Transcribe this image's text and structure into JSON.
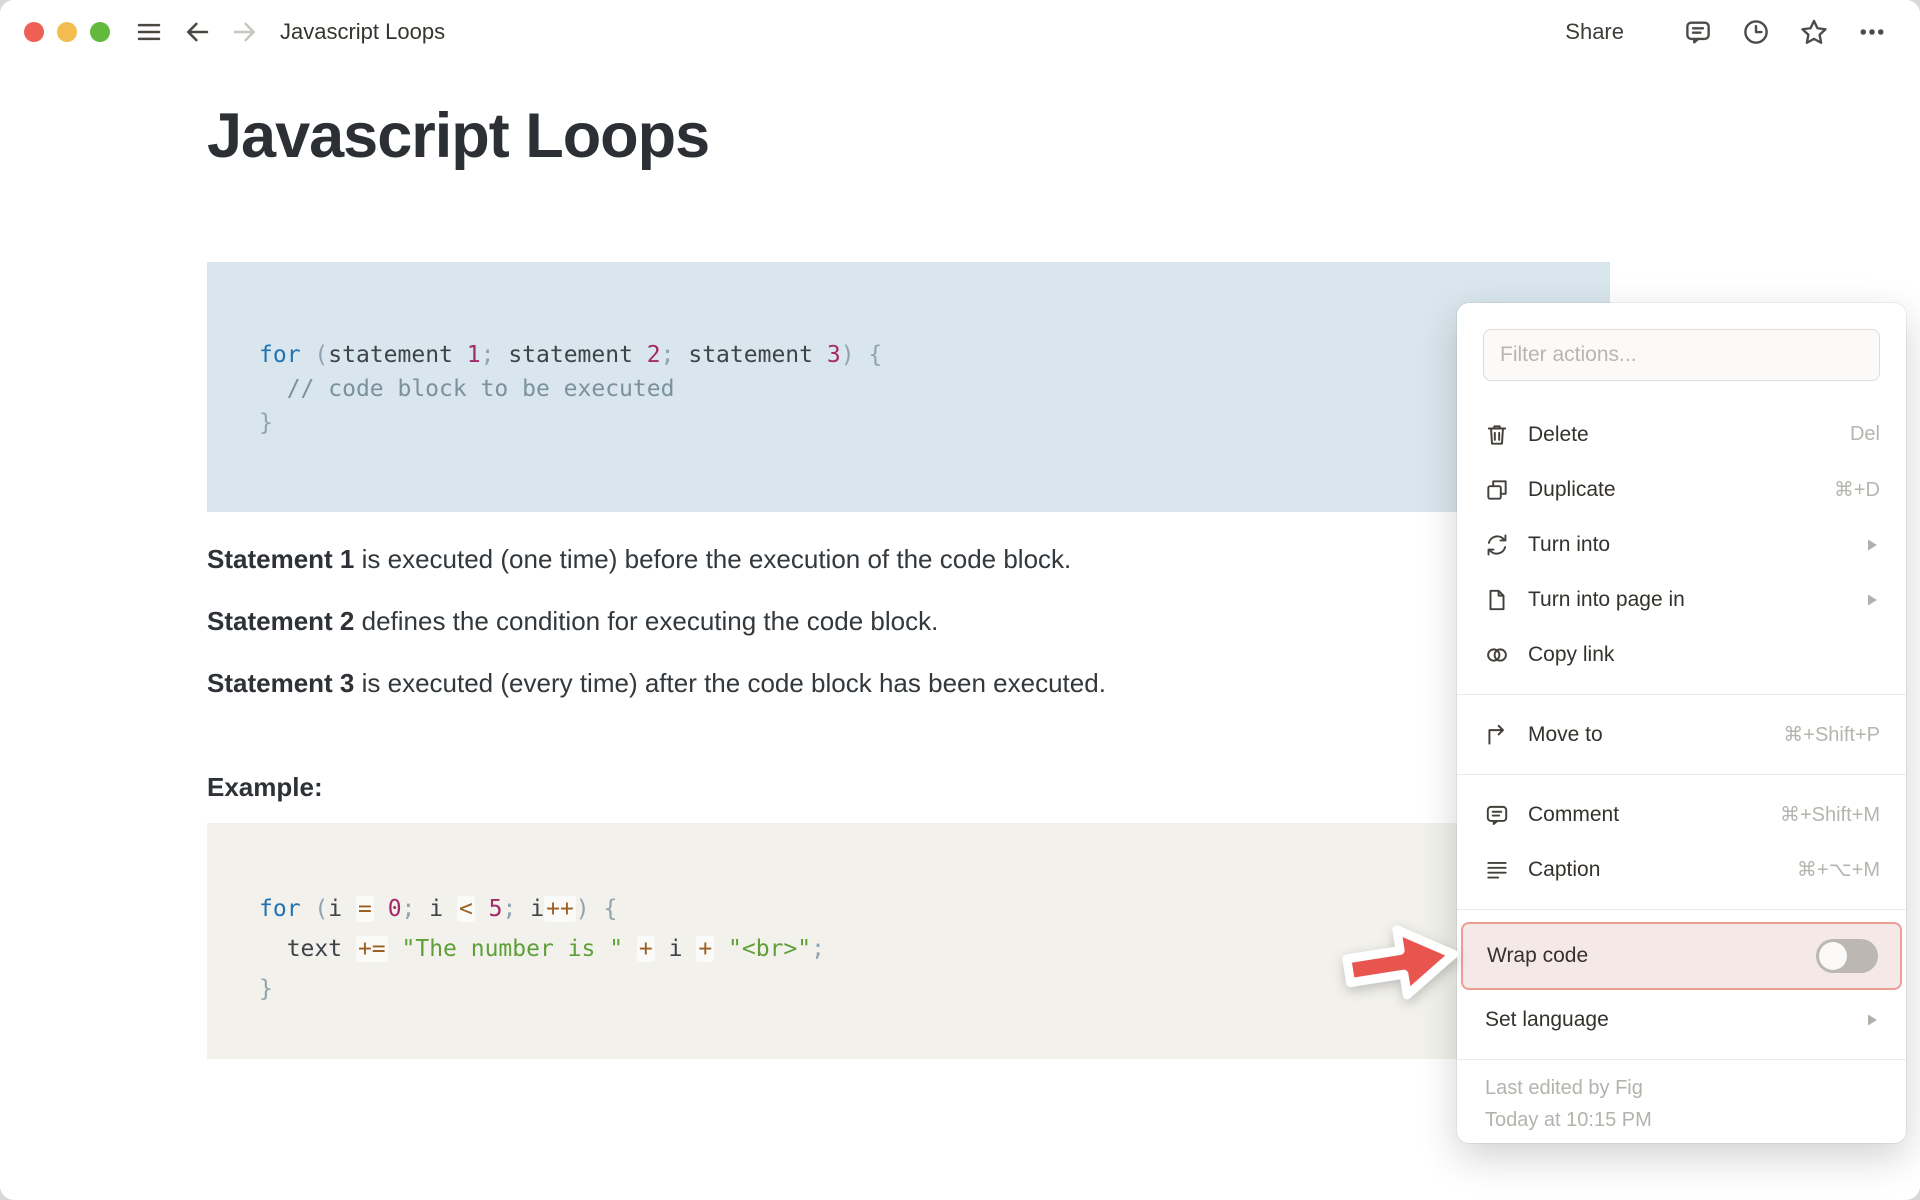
{
  "topbar": {
    "title": "Javascript Loops",
    "share_label": "Share"
  },
  "page": {
    "title": "Javascript Loops",
    "example_label": "Example:",
    "paragraphs": [
      {
        "bold": "Statement 1",
        "text": " is executed (one time) before the execution of the code block."
      },
      {
        "bold": "Statement 2",
        "text": " defines the condition for executing the code block."
      },
      {
        "bold": "Statement 3",
        "text": " is executed (every time) after the code block has been executed."
      }
    ],
    "code_blocks": [
      {
        "style": "blue",
        "lines": [
          [
            [
              "kw",
              "for"
            ],
            [
              "pl",
              " "
            ],
            [
              "pun",
              "("
            ],
            [
              "pl",
              "statement "
            ],
            [
              "num",
              "1"
            ],
            [
              "pun",
              ";"
            ],
            [
              "pl",
              " statement "
            ],
            [
              "num",
              "2"
            ],
            [
              "pun",
              ";"
            ],
            [
              "pl",
              " statement "
            ],
            [
              "num",
              "3"
            ],
            [
              "pun",
              ")"
            ],
            [
              "pl",
              " "
            ],
            [
              "pun",
              "{"
            ]
          ],
          [
            [
              "pl",
              "  "
            ],
            [
              "com",
              "// code block to be executed"
            ]
          ],
          [
            [
              "pun",
              "}"
            ]
          ]
        ]
      },
      {
        "style": "gray",
        "lines": [
          [
            [
              "kw",
              "for"
            ],
            [
              "pl",
              " "
            ],
            [
              "pun",
              "("
            ],
            [
              "pl",
              "i "
            ],
            [
              "op",
              "="
            ],
            [
              "pl",
              " "
            ],
            [
              "num",
              "0"
            ],
            [
              "pun",
              ";"
            ],
            [
              "pl",
              " i "
            ],
            [
              "op",
              "<"
            ],
            [
              "pl",
              " "
            ],
            [
              "num",
              "5"
            ],
            [
              "pun",
              ";"
            ],
            [
              "pl",
              " i"
            ],
            [
              "op",
              "++"
            ],
            [
              "pun",
              ")"
            ],
            [
              "pl",
              " "
            ],
            [
              "pun",
              "{"
            ]
          ],
          [
            [
              "pl",
              "  text "
            ],
            [
              "op",
              "+="
            ],
            [
              "pl",
              " "
            ],
            [
              "str",
              "\"The number is \""
            ],
            [
              "pl",
              " "
            ],
            [
              "op",
              "+"
            ],
            [
              "pl",
              " i "
            ],
            [
              "op",
              "+"
            ],
            [
              "pl",
              " "
            ],
            [
              "str",
              "\"<br>\""
            ],
            [
              "pun",
              ";"
            ]
          ],
          [
            [
              "pun",
              "}"
            ]
          ]
        ]
      }
    ]
  },
  "menu": {
    "filter_placeholder": "Filter actions...",
    "items": [
      {
        "icon": "trash-icon",
        "label": "Delete",
        "shortcut": "Del"
      },
      {
        "icon": "duplicate-icon",
        "label": "Duplicate",
        "shortcut": "⌘+D"
      },
      {
        "icon": "turn-into-icon",
        "label": "Turn into",
        "submenu": true
      },
      {
        "icon": "page-icon",
        "label": "Turn into page in",
        "submenu": true
      },
      {
        "icon": "copy-link-icon",
        "label": "Copy link"
      },
      {
        "divider": true
      },
      {
        "icon": "move-to-icon",
        "label": "Move to",
        "shortcut": "⌘+Shift+P"
      },
      {
        "divider": true
      },
      {
        "icon": "comment-icon",
        "label": "Comment",
        "shortcut": "⌘+Shift+M"
      },
      {
        "icon": "caption-icon",
        "label": "Caption",
        "shortcut": "⌘+⌥+M"
      },
      {
        "divider": true
      },
      {
        "label": "Wrap code",
        "toggle": "off",
        "highlighted": true
      },
      {
        "label": "Set language",
        "submenu": true
      },
      {
        "divider": true
      },
      {
        "label": "Last edited by Fig",
        "meta": true
      },
      {
        "label": "Today at 10:15 PM",
        "meta": true
      }
    ]
  },
  "colors": {
    "accent-red": "#e8554e",
    "highlight-border": "#ec9e94",
    "highlight-bg": "#f4e9e7",
    "code-blue-bg": "#d9e6ed",
    "code-gray-bg": "#f2f1ec",
    "kw": "#2273b0",
    "num": "#a32a68",
    "str": "#5f9f38",
    "pun": "#8fa3b0",
    "com": "#7b919e",
    "op": "#9b5f23"
  }
}
